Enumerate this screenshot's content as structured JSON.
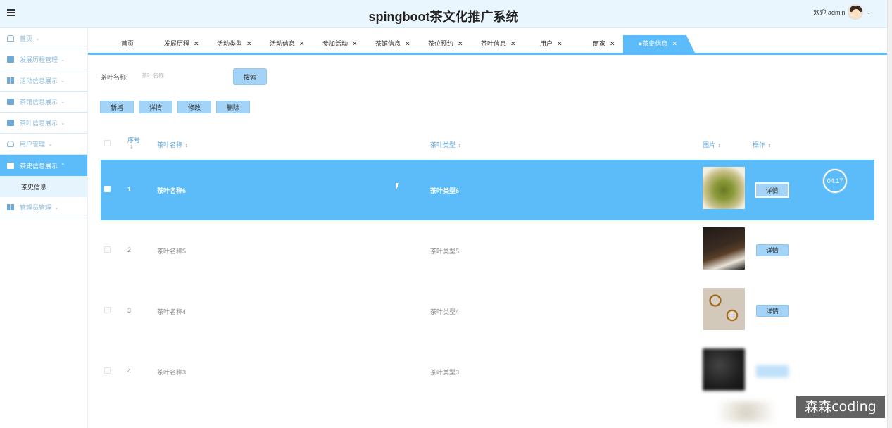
{
  "header": {
    "title": "spingboot茶文化推广系统",
    "welcome": "欢迎 admin"
  },
  "sidebar": {
    "items": [
      {
        "label": "首页",
        "icon": "home-icon"
      },
      {
        "label": "发展历程管理",
        "icon": "box-icon"
      },
      {
        "label": "活动信息展示",
        "icon": "grid-icon"
      },
      {
        "label": "茶馆信息展示",
        "icon": "box-icon"
      },
      {
        "label": "茶叶信息展示",
        "icon": "box-icon"
      },
      {
        "label": "用户管理",
        "icon": "user-icon"
      },
      {
        "label": "茶史信息展示",
        "icon": "box-icon",
        "active": true
      },
      {
        "label": "管理员管理",
        "icon": "grid-icon"
      }
    ],
    "sub_item": "茶史信息"
  },
  "tabs": [
    {
      "label": "首页",
      "closable": false
    },
    {
      "label": "发展历程",
      "closable": true
    },
    {
      "label": "活动类型",
      "closable": true
    },
    {
      "label": "活动信息",
      "closable": true
    },
    {
      "label": "参加活动",
      "closable": true
    },
    {
      "label": "茶馆信息",
      "closable": true
    },
    {
      "label": "茶位预约",
      "closable": true
    },
    {
      "label": "茶叶信息",
      "closable": true
    },
    {
      "label": "用户",
      "closable": true
    },
    {
      "label": "商家",
      "closable": true
    },
    {
      "label": "●茶史信息",
      "closable": true,
      "active": true
    }
  ],
  "search": {
    "label": "茶叶名称:",
    "placeholder": "茶叶名称",
    "button": "搜索"
  },
  "actions": {
    "add": "新增",
    "detail": "详情",
    "edit": "修改",
    "delete": "删除"
  },
  "table": {
    "columns": [
      "序号",
      "茶叶名称",
      "茶叶类型",
      "图片",
      "操作"
    ],
    "rows": [
      {
        "index": "1",
        "name": "茶叶名称6",
        "type": "茶叶类型6",
        "action": "详情",
        "selected": true
      },
      {
        "index": "2",
        "name": "茶叶名称5",
        "type": "茶叶类型5",
        "action": "详情"
      },
      {
        "index": "3",
        "name": "茶叶名称4",
        "type": "茶叶类型4",
        "action": "详情"
      },
      {
        "index": "4",
        "name": "茶叶名称3",
        "type": "茶叶类型3",
        "action": ""
      }
    ]
  },
  "timer": "04:17",
  "watermark": "森森coding",
  "colors": {
    "accent": "#5bbcf9",
    "button": "#a3d4f7",
    "header_bg": "#eaf6fd"
  }
}
